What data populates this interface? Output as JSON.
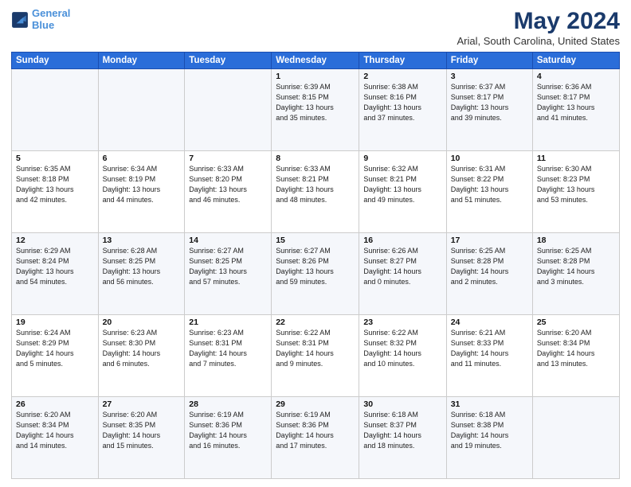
{
  "header": {
    "logo_line1": "General",
    "logo_line2": "Blue",
    "main_title": "May 2024",
    "subtitle": "Arial, South Carolina, United States"
  },
  "calendar": {
    "days_of_week": [
      "Sunday",
      "Monday",
      "Tuesday",
      "Wednesday",
      "Thursday",
      "Friday",
      "Saturday"
    ],
    "weeks": [
      [
        {
          "day": "",
          "info": ""
        },
        {
          "day": "",
          "info": ""
        },
        {
          "day": "",
          "info": ""
        },
        {
          "day": "1",
          "info": "Sunrise: 6:39 AM\nSunset: 8:15 PM\nDaylight: 13 hours\nand 35 minutes."
        },
        {
          "day": "2",
          "info": "Sunrise: 6:38 AM\nSunset: 8:16 PM\nDaylight: 13 hours\nand 37 minutes."
        },
        {
          "day": "3",
          "info": "Sunrise: 6:37 AM\nSunset: 8:17 PM\nDaylight: 13 hours\nand 39 minutes."
        },
        {
          "day": "4",
          "info": "Sunrise: 6:36 AM\nSunset: 8:17 PM\nDaylight: 13 hours\nand 41 minutes."
        }
      ],
      [
        {
          "day": "5",
          "info": "Sunrise: 6:35 AM\nSunset: 8:18 PM\nDaylight: 13 hours\nand 42 minutes."
        },
        {
          "day": "6",
          "info": "Sunrise: 6:34 AM\nSunset: 8:19 PM\nDaylight: 13 hours\nand 44 minutes."
        },
        {
          "day": "7",
          "info": "Sunrise: 6:33 AM\nSunset: 8:20 PM\nDaylight: 13 hours\nand 46 minutes."
        },
        {
          "day": "8",
          "info": "Sunrise: 6:33 AM\nSunset: 8:21 PM\nDaylight: 13 hours\nand 48 minutes."
        },
        {
          "day": "9",
          "info": "Sunrise: 6:32 AM\nSunset: 8:21 PM\nDaylight: 13 hours\nand 49 minutes."
        },
        {
          "day": "10",
          "info": "Sunrise: 6:31 AM\nSunset: 8:22 PM\nDaylight: 13 hours\nand 51 minutes."
        },
        {
          "day": "11",
          "info": "Sunrise: 6:30 AM\nSunset: 8:23 PM\nDaylight: 13 hours\nand 53 minutes."
        }
      ],
      [
        {
          "day": "12",
          "info": "Sunrise: 6:29 AM\nSunset: 8:24 PM\nDaylight: 13 hours\nand 54 minutes."
        },
        {
          "day": "13",
          "info": "Sunrise: 6:28 AM\nSunset: 8:25 PM\nDaylight: 13 hours\nand 56 minutes."
        },
        {
          "day": "14",
          "info": "Sunrise: 6:27 AM\nSunset: 8:25 PM\nDaylight: 13 hours\nand 57 minutes."
        },
        {
          "day": "15",
          "info": "Sunrise: 6:27 AM\nSunset: 8:26 PM\nDaylight: 13 hours\nand 59 minutes."
        },
        {
          "day": "16",
          "info": "Sunrise: 6:26 AM\nSunset: 8:27 PM\nDaylight: 14 hours\nand 0 minutes."
        },
        {
          "day": "17",
          "info": "Sunrise: 6:25 AM\nSunset: 8:28 PM\nDaylight: 14 hours\nand 2 minutes."
        },
        {
          "day": "18",
          "info": "Sunrise: 6:25 AM\nSunset: 8:28 PM\nDaylight: 14 hours\nand 3 minutes."
        }
      ],
      [
        {
          "day": "19",
          "info": "Sunrise: 6:24 AM\nSunset: 8:29 PM\nDaylight: 14 hours\nand 5 minutes."
        },
        {
          "day": "20",
          "info": "Sunrise: 6:23 AM\nSunset: 8:30 PM\nDaylight: 14 hours\nand 6 minutes."
        },
        {
          "day": "21",
          "info": "Sunrise: 6:23 AM\nSunset: 8:31 PM\nDaylight: 14 hours\nand 7 minutes."
        },
        {
          "day": "22",
          "info": "Sunrise: 6:22 AM\nSunset: 8:31 PM\nDaylight: 14 hours\nand 9 minutes."
        },
        {
          "day": "23",
          "info": "Sunrise: 6:22 AM\nSunset: 8:32 PM\nDaylight: 14 hours\nand 10 minutes."
        },
        {
          "day": "24",
          "info": "Sunrise: 6:21 AM\nSunset: 8:33 PM\nDaylight: 14 hours\nand 11 minutes."
        },
        {
          "day": "25",
          "info": "Sunrise: 6:20 AM\nSunset: 8:34 PM\nDaylight: 14 hours\nand 13 minutes."
        }
      ],
      [
        {
          "day": "26",
          "info": "Sunrise: 6:20 AM\nSunset: 8:34 PM\nDaylight: 14 hours\nand 14 minutes."
        },
        {
          "day": "27",
          "info": "Sunrise: 6:20 AM\nSunset: 8:35 PM\nDaylight: 14 hours\nand 15 minutes."
        },
        {
          "day": "28",
          "info": "Sunrise: 6:19 AM\nSunset: 8:36 PM\nDaylight: 14 hours\nand 16 minutes."
        },
        {
          "day": "29",
          "info": "Sunrise: 6:19 AM\nSunset: 8:36 PM\nDaylight: 14 hours\nand 17 minutes."
        },
        {
          "day": "30",
          "info": "Sunrise: 6:18 AM\nSunset: 8:37 PM\nDaylight: 14 hours\nand 18 minutes."
        },
        {
          "day": "31",
          "info": "Sunrise: 6:18 AM\nSunset: 8:38 PM\nDaylight: 14 hours\nand 19 minutes."
        },
        {
          "day": "",
          "info": ""
        }
      ]
    ]
  }
}
